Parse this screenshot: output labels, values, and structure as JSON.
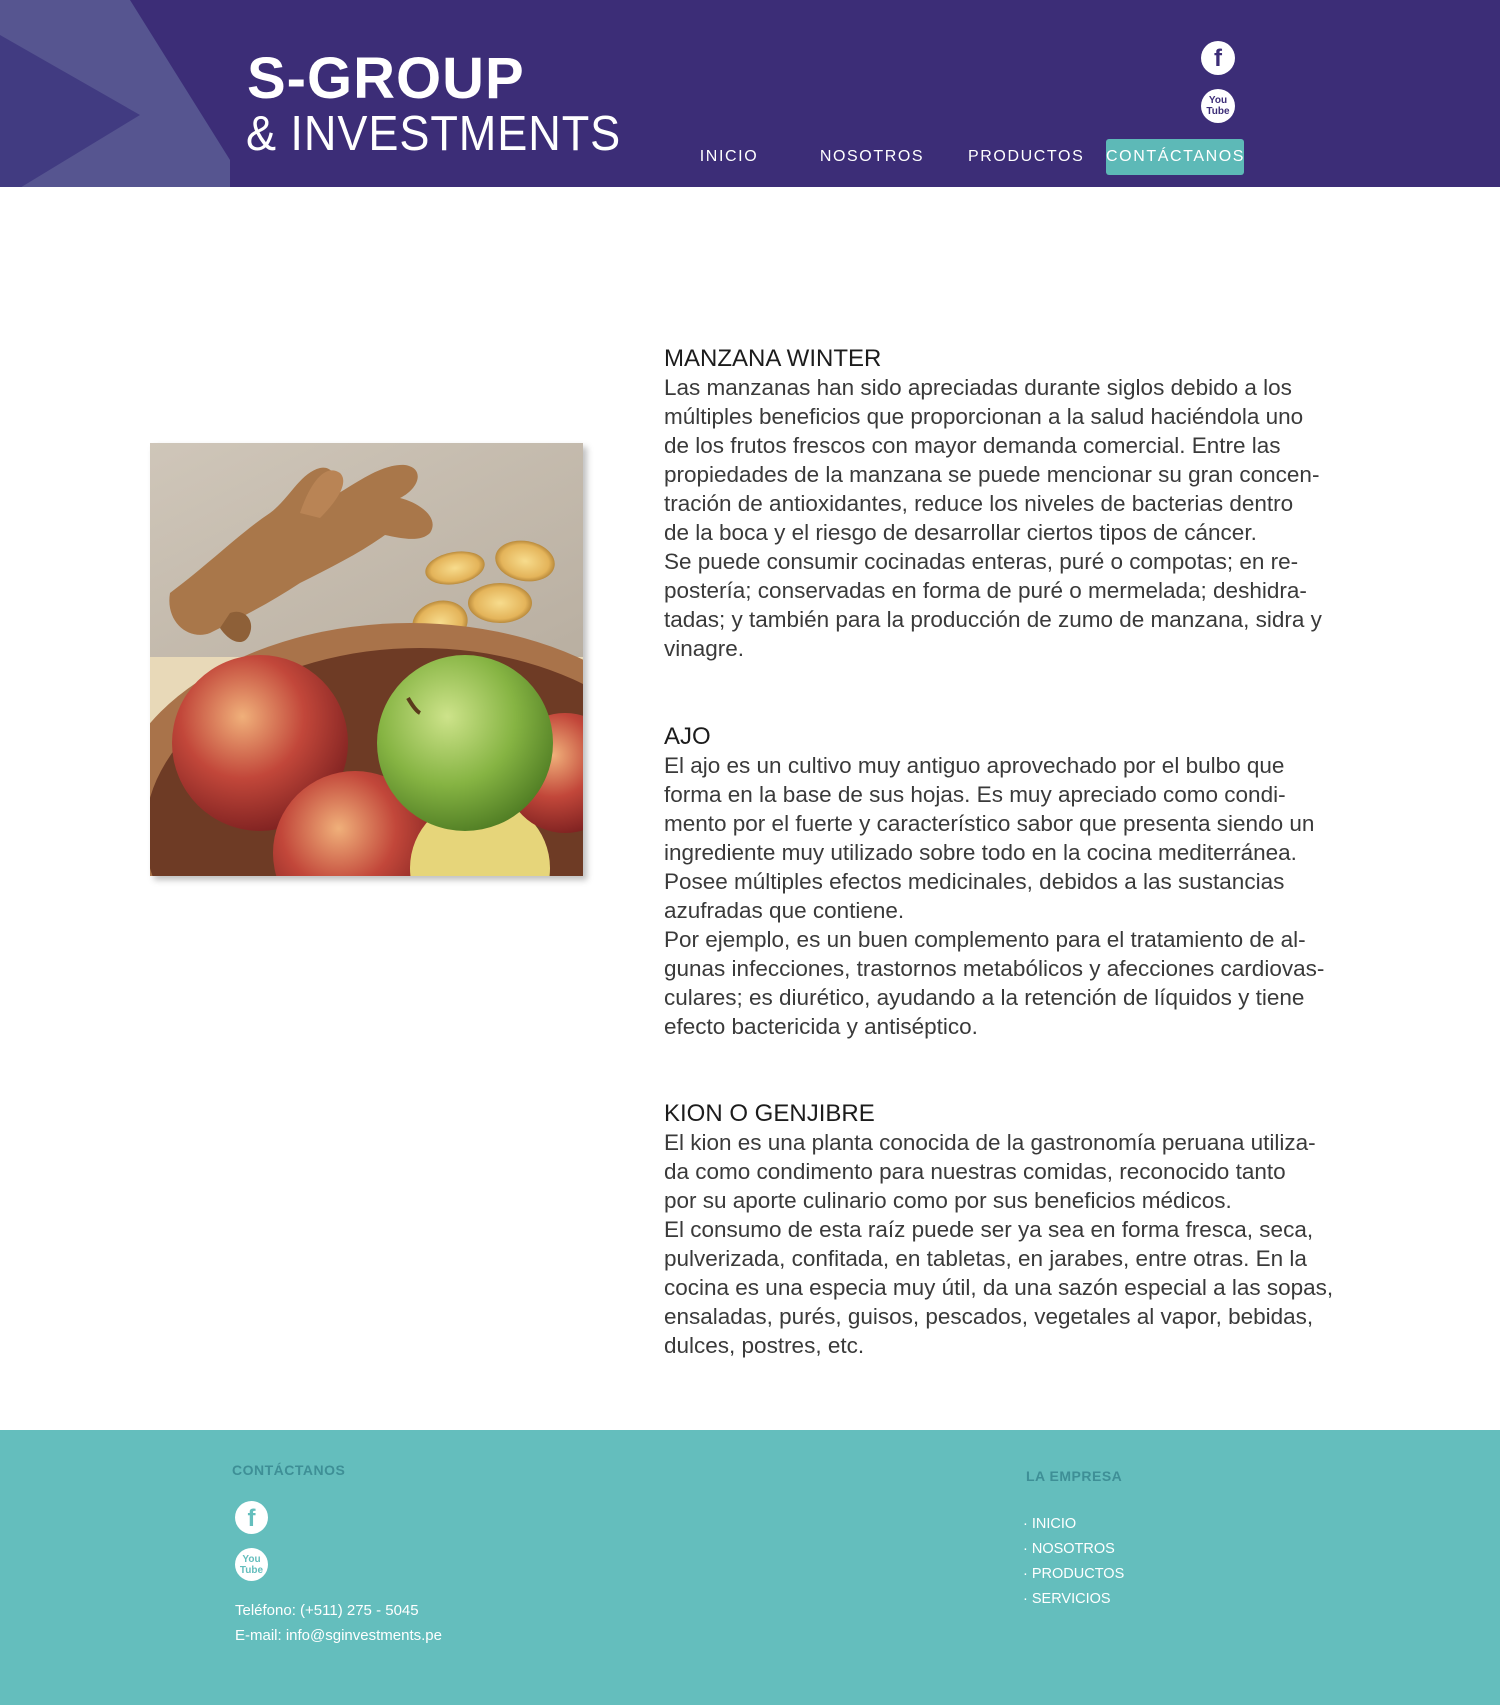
{
  "colors": {
    "header_bg": "#3c2d77",
    "accent_teal": "#5db9b7",
    "footer_bg": "#64bebd",
    "footer_heading": "#3e8f96"
  },
  "header": {
    "logo_line1": "S-GROUP",
    "logo_line2": "& INVESTMENTS",
    "social": [
      {
        "icon": "facebook-icon",
        "glyph": "f"
      },
      {
        "icon": "youtube-icon",
        "glyph_top": "You",
        "glyph_bottom": "Tube"
      }
    ],
    "nav": [
      {
        "label": "INICIO",
        "active": false
      },
      {
        "label": "NOSOTROS",
        "active": false
      },
      {
        "label": "PRODUCTOS",
        "active": false
      },
      {
        "label": "CONTÁCTANOS",
        "active": true
      }
    ]
  },
  "products": [
    {
      "title": "MANZANA WINTER",
      "lines": [
        "Las manzanas han sido apreciadas durante siglos debido a los",
        "múltiples beneficios que proporcionan a la salud haciéndola uno",
        "de los frutos frescos con mayor demanda comercial. Entre las",
        "propiedades de la manzana se puede mencionar su gran concen-",
        "tración de antioxidantes, reduce los niveles de bacterias dentro",
        "de la boca y el riesgo de desarrollar ciertos tipos de cáncer.",
        "Se puede consumir cocinadas enteras, puré o compotas; en re-",
        "postería; conservadas en forma de puré o mermelada; deshidra-",
        "tadas; y también para la producción de zumo de manzana, sidra y",
        "vinagre."
      ]
    },
    {
      "title": "AJO",
      "lines": [
        "El ajo es un cultivo muy antiguo aprovechado por el bulbo que",
        "forma en la base de sus hojas. Es muy apreciado como condi-",
        "mento por el fuerte y característico sabor que presenta siendo un",
        "ingrediente muy utilizado sobre todo en la cocina mediterránea.",
        "Posee múltiples efectos medicinales, debidos a las sustancias",
        "azufradas que contiene.",
        "Por ejemplo, es un buen complemento para el tratamiento de al-",
        "gunas infecciones, trastornos metabólicos y afecciones cardiovas-",
        "culares; es diurético, ayudando a la retención de líquidos y tiene",
        "efecto bactericida y antiséptico."
      ]
    },
    {
      "title": "KION O GENJIBRE",
      "lines": [
        "El kion es una planta conocida de la gastronomía peruana utiliza-",
        "da como condimento para nuestras comidas, reconocido tanto",
        "por su aporte culinario como por sus beneficios médicos.",
        "El consumo de esta raíz puede ser ya sea en forma fresca, seca,",
        "pulverizada, confitada, en tabletas, en jarabes, entre otras. En la",
        "cocina es una especia muy útil, da una sazón especial a las sopas,",
        "ensaladas, purés, guisos, pescados, vegetales al vapor, bebidas,",
        "dulces, postres, etc."
      ]
    }
  ],
  "footer": {
    "contact_heading": "CONTÁCTANOS",
    "phone": "Teléfono: (+511) 275 - 5045",
    "email": "E-mail: info@sginvestments.pe",
    "company_heading": "LA EMPRESA",
    "links": [
      "· INICIO",
      "· NOSOTROS",
      "· PRODUCTOS",
      "· SERVICIOS"
    ]
  }
}
